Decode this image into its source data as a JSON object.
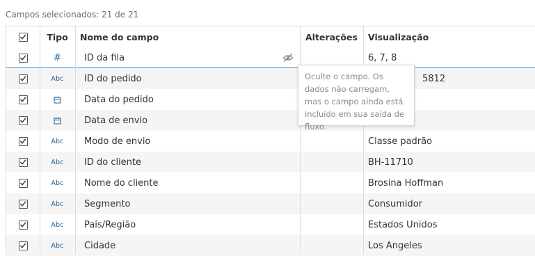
{
  "summary": "Campos selecionados: 21 de 21",
  "columns": {
    "type": "Tipo",
    "name": "Nome do campo",
    "changes": "Alterações",
    "preview": "Visualização"
  },
  "rows": [
    {
      "type": "number",
      "type_label": "#",
      "name": "ID da fila",
      "preview": "6, 7, 8"
    },
    {
      "type": "string",
      "type_label": "Abc",
      "name": "ID do pedido",
      "preview": "5812"
    },
    {
      "type": "date",
      "type_label": "calendar",
      "name": "Data do pedido",
      "preview": ""
    },
    {
      "type": "date",
      "type_label": "calendar",
      "name": "Data de envio",
      "preview": ""
    },
    {
      "type": "string",
      "type_label": "Abc",
      "name": "Modo de envio",
      "preview": "Classe padrão"
    },
    {
      "type": "string",
      "type_label": "Abc",
      "name": "ID do cliente",
      "preview": "BH-11710"
    },
    {
      "type": "string",
      "type_label": "Abc",
      "name": "Nome do cliente",
      "preview": "Brosina Hoffman"
    },
    {
      "type": "string",
      "type_label": "Abc",
      "name": "Segmento",
      "preview": "Consumidor"
    },
    {
      "type": "string",
      "type_label": "Abc",
      "name": "País/Região",
      "preview": "Estados Unidos"
    },
    {
      "type": "string",
      "type_label": "Abc",
      "name": "Cidade",
      "preview": "Los Angeles"
    }
  ],
  "tooltip": "Oculte o campo. Os dados não carregam, mas o campo ainda está incluído em sua saída de fluxo.",
  "colors": {
    "accent": "#4f8fcf",
    "type_icon": "#1f5f95",
    "stripe": "#f5f5f5"
  }
}
